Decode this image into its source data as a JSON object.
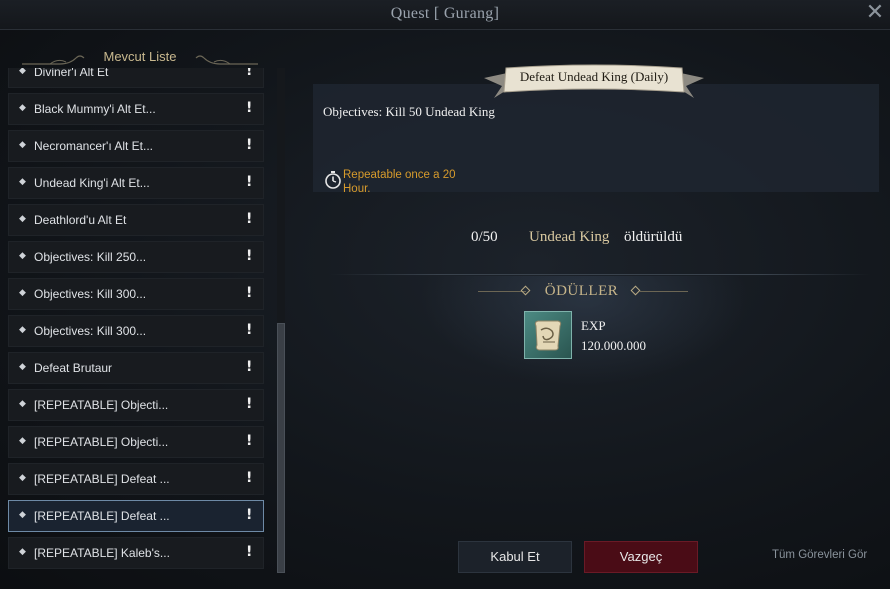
{
  "window": {
    "title": "Quest [ Gurang]"
  },
  "list": {
    "header": "Mevcut Liste",
    "items": [
      {
        "label": "Diviner'ı Alt Et"
      },
      {
        "label": "Black Mummy'i Alt Et..."
      },
      {
        "label": "Necromancer'ı Alt Et..."
      },
      {
        "label": "Undead King'i Alt Et..."
      },
      {
        "label": "Deathlord'u Alt Et"
      },
      {
        "label": "Objectives: Kill 250..."
      },
      {
        "label": "Objectives: Kill 300..."
      },
      {
        "label": "Objectives: Kill 300..."
      },
      {
        "label": "Defeat Brutaur"
      },
      {
        "label": "[REPEATABLE] Objecti..."
      },
      {
        "label": "[REPEATABLE] Objecti..."
      },
      {
        "label": "[REPEATABLE] Defeat ..."
      },
      {
        "label": "[REPEATABLE] Defeat ..."
      },
      {
        "label": "[REPEATABLE] Kaleb's..."
      }
    ],
    "selected_index": 12,
    "scroll_fraction": 1.0
  },
  "quest": {
    "title": "Defeat Undead King (Daily)",
    "objective": "Objectives: Kill 50 Undead King",
    "repeat_note": "Repeatable once a 20 Hour.",
    "progress": {
      "count": "0/50",
      "target": "Undead King",
      "suffix": "öldürüldü"
    }
  },
  "rewards": {
    "title": "ÖDÜLLER",
    "items": [
      {
        "name": "EXP",
        "amount": "120.000.000",
        "icon": "scroll-icon"
      }
    ]
  },
  "buttons": {
    "accept": "Kabul Et",
    "cancel": "Vazgeç",
    "all_quests": "Tüm Görevleri Gör"
  },
  "colors": {
    "accent_gold": "#c7b58a",
    "repeat_orange": "#d79b2c",
    "cancel_red": "#4a0c16",
    "selected_border": "#6e8aa6"
  }
}
